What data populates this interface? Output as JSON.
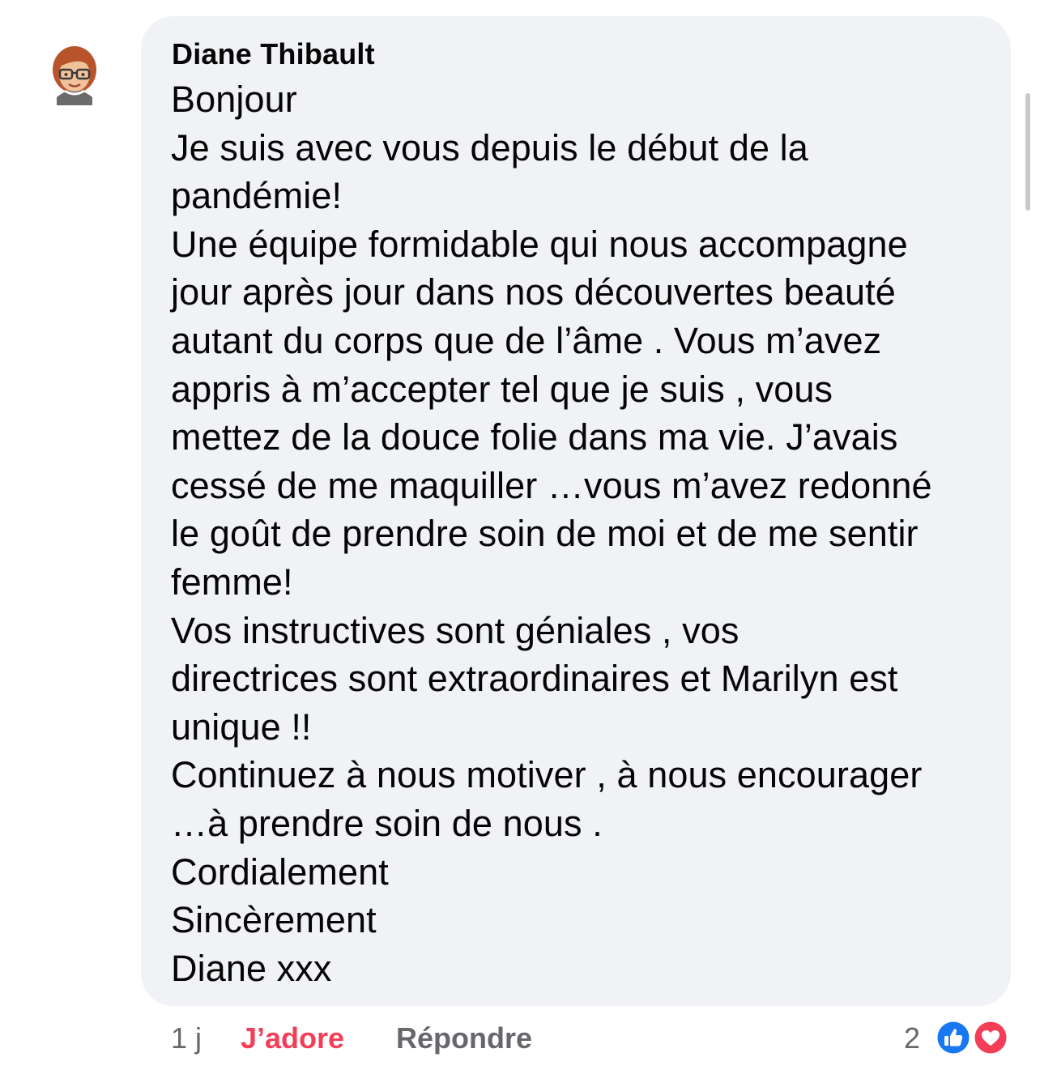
{
  "comment": {
    "author": "Diane Thibault",
    "lines": [
      "Bonjour",
      "Je suis avec vous depuis le début de la",
      "pandémie!",
      "Une équipe formidable qui nous accompagne",
      "jour après jour dans nos découvertes beauté",
      "autant du corps que de l’âme .  Vous m’avez",
      "appris à m’accepter tel que je suis , vous",
      "mettez de la douce folie dans ma vie.  J’avais",
      "cessé de me maquiller …vous m’avez redonné",
      "le goût de prendre soin de moi et de me sentir",
      "femme!",
      "Vos instructives sont géniales , vos",
      "directrices sont extraordinaires et Marilyn est",
      "unique !!",
      "Continuez à nous motiver , à nous encourager",
      "…à prendre soin de nous .",
      "Cordialement",
      "Sincèrement",
      "Diane xxx"
    ]
  },
  "actions": {
    "time": "1 j",
    "like_label": "J’adore",
    "reply_label": "Répondre"
  },
  "reactions": {
    "count": "2",
    "icons": [
      "like-icon",
      "love-icon"
    ],
    "like_color": "#1877f2",
    "love_color": "#f33e58"
  },
  "colors": {
    "bubble": "#f0f2f5",
    "muted_text": "#65676b",
    "active_like": "#f33e58"
  }
}
